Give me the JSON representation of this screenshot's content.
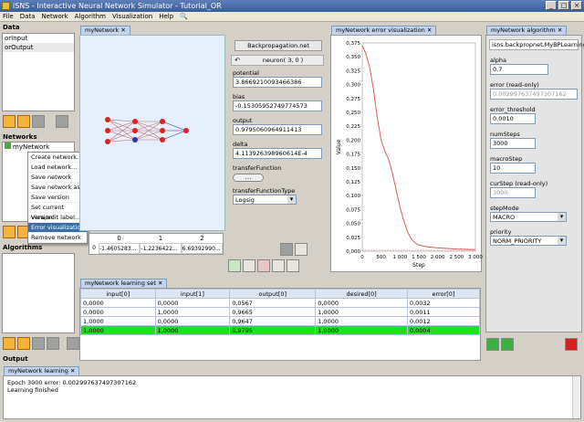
{
  "title": "iSNS - Interactive Neural Network Simulator - Tutorial_OR",
  "window_buttons": [
    "_",
    "□",
    "×"
  ],
  "menu": [
    "File",
    "Data",
    "Network",
    "Algorithm",
    "Visualization",
    "Help"
  ],
  "data_panel": {
    "title": "Data",
    "items": [
      "orInput",
      "orOutput"
    ]
  },
  "networks_panel": {
    "title": "Networks",
    "items": [
      "myNetwork"
    ]
  },
  "algorithms_panel": {
    "title": "Algorithms"
  },
  "context_menu": [
    "Create network...",
    "Load network...",
    "Save network",
    "Save network as...",
    "Save version",
    "Set current version",
    "View/edit label...",
    "Error visualization",
    "Remove network"
  ],
  "network_tab": "myNetwork",
  "network_table": {
    "cols": [
      "0",
      "1",
      "2"
    ],
    "row_index": "0",
    "values": [
      "-1.4605283...",
      "-1.2236422...",
      "6.69392990..."
    ]
  },
  "neuron_panel": {
    "title": "Backpropagation.net",
    "neuron_label": "neuron( 3, 0 )",
    "fields": [
      {
        "label": "potential",
        "value": "3.8669210093466386"
      },
      {
        "label": "bias",
        "value": "-0.15305952749774573"
      },
      {
        "label": "output",
        "value": "0.9795060964911413"
      },
      {
        "label": "delta",
        "value": "4.113926398960614E-4"
      }
    ],
    "transfer_function_label": "transferFunction",
    "transfer_function_type_label": "transferFunctionType",
    "transfer_function_type_value": "Logsig"
  },
  "error_tab": "myNetwork error visualization",
  "chart_data": {
    "type": "line",
    "title": "",
    "xlabel": "Step",
    "ylabel": "Value",
    "xlim": [
      0,
      3000
    ],
    "ylim": [
      0,
      0.375
    ],
    "xticks": [
      "0",
      "500",
      "1 000",
      "1 500",
      "2 000",
      "2 500",
      "3 000"
    ],
    "yticks": [
      "0,000",
      "0,025",
      "0,050",
      "0,075",
      "0,100",
      "0,125",
      "0,150",
      "0,175",
      "0,200",
      "0,225",
      "0,250",
      "0,275",
      "0,300",
      "0,325",
      "0,350",
      "0,375"
    ],
    "series": [
      {
        "color": "#e05a5a",
        "x": [
          0,
          100,
          200,
          300,
          400,
          500,
          600,
          700,
          800,
          900,
          1000,
          1100,
          1200,
          1300,
          1400,
          1500,
          1700,
          2000,
          2500,
          3000
        ],
        "y": [
          0.37,
          0.355,
          0.33,
          0.29,
          0.24,
          0.2,
          0.18,
          0.165,
          0.14,
          0.11,
          0.08,
          0.055,
          0.035,
          0.022,
          0.015,
          0.011,
          0.008,
          0.006,
          0.004,
          0.003
        ]
      }
    ]
  },
  "learning_set": {
    "tab": "myNetwork learning set",
    "headers": [
      "input[0]",
      "input[1]",
      "output[0]",
      "desired[0]",
      "error[0]"
    ],
    "rows": [
      [
        "0,0000",
        "0,0000",
        "0,0567",
        "0,0000",
        "0,0032"
      ],
      [
        "0,0000",
        "1,0000",
        "0,9665",
        "1,0000",
        "0,0011"
      ],
      [
        "1,0000",
        "0,0000",
        "0,9647",
        "1,0000",
        "0,0012"
      ],
      [
        "1,0000",
        "1,0000",
        "0,9795",
        "1,0000",
        "0,0004"
      ]
    ]
  },
  "algorithm_panel": {
    "tab": "myNetwork algorithm",
    "name": "isns.backpropnet.MyBPLearning",
    "fields": [
      {
        "label": "alpha",
        "value": "0.7",
        "ro": false
      },
      {
        "label": "error (read-only)",
        "value": "0.002997637497307162",
        "ro": true
      },
      {
        "label": "error_threshold",
        "value": "0.0010",
        "ro": false
      },
      {
        "label": "numSteps",
        "value": "3000",
        "ro": false
      },
      {
        "label": "macroStep",
        "value": "10",
        "ro": false
      },
      {
        "label": "curStep (read-only)",
        "value": "3000",
        "ro": true
      }
    ],
    "step_mode_label": "stepMode",
    "step_mode_value": "MACRO",
    "priority_label": "priority",
    "priority_value": "NORM_PRIORITY"
  },
  "output": {
    "title": "Output",
    "tab": "myNetwork learning",
    "lines": [
      "Epoch 3000 error: 0.002997637497307162",
      "Learning finished"
    ]
  },
  "colors": {
    "highlight_row": "#22dd22",
    "neuron_red": "#dd2222",
    "neuron_blue": "#3333aa"
  }
}
